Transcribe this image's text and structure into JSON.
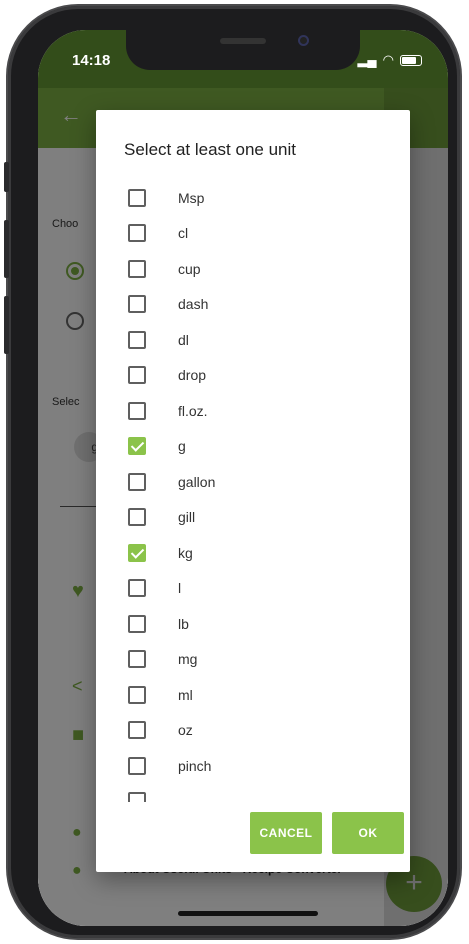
{
  "status_bar": {
    "time": "14:18"
  },
  "background": {
    "label_choose": "Choo",
    "label_select": "Selec",
    "chip_text": "g",
    "footer_text": "About Useful Units - Recipe Converter",
    "fab_symbol": "+"
  },
  "dialog": {
    "title": "Select at least one unit",
    "units": [
      {
        "label": "Msp",
        "checked": false
      },
      {
        "label": "cl",
        "checked": false
      },
      {
        "label": "cup",
        "checked": false
      },
      {
        "label": "dash",
        "checked": false
      },
      {
        "label": "dl",
        "checked": false
      },
      {
        "label": "drop",
        "checked": false
      },
      {
        "label": "fl.oz.",
        "checked": false
      },
      {
        "label": "g",
        "checked": true
      },
      {
        "label": "gallon",
        "checked": false
      },
      {
        "label": "gill",
        "checked": false
      },
      {
        "label": "kg",
        "checked": true
      },
      {
        "label": "l",
        "checked": false
      },
      {
        "label": "lb",
        "checked": false
      },
      {
        "label": "mg",
        "checked": false
      },
      {
        "label": "ml",
        "checked": false
      },
      {
        "label": "oz",
        "checked": false
      },
      {
        "label": "pinch",
        "checked": false
      },
      {
        "label": "",
        "checked": false
      }
    ],
    "cancel_label": "CANCEL",
    "ok_label": "OK"
  },
  "colors": {
    "accent": "#8bc34a",
    "toolbar": "#7fb245",
    "status": "#679a35"
  }
}
